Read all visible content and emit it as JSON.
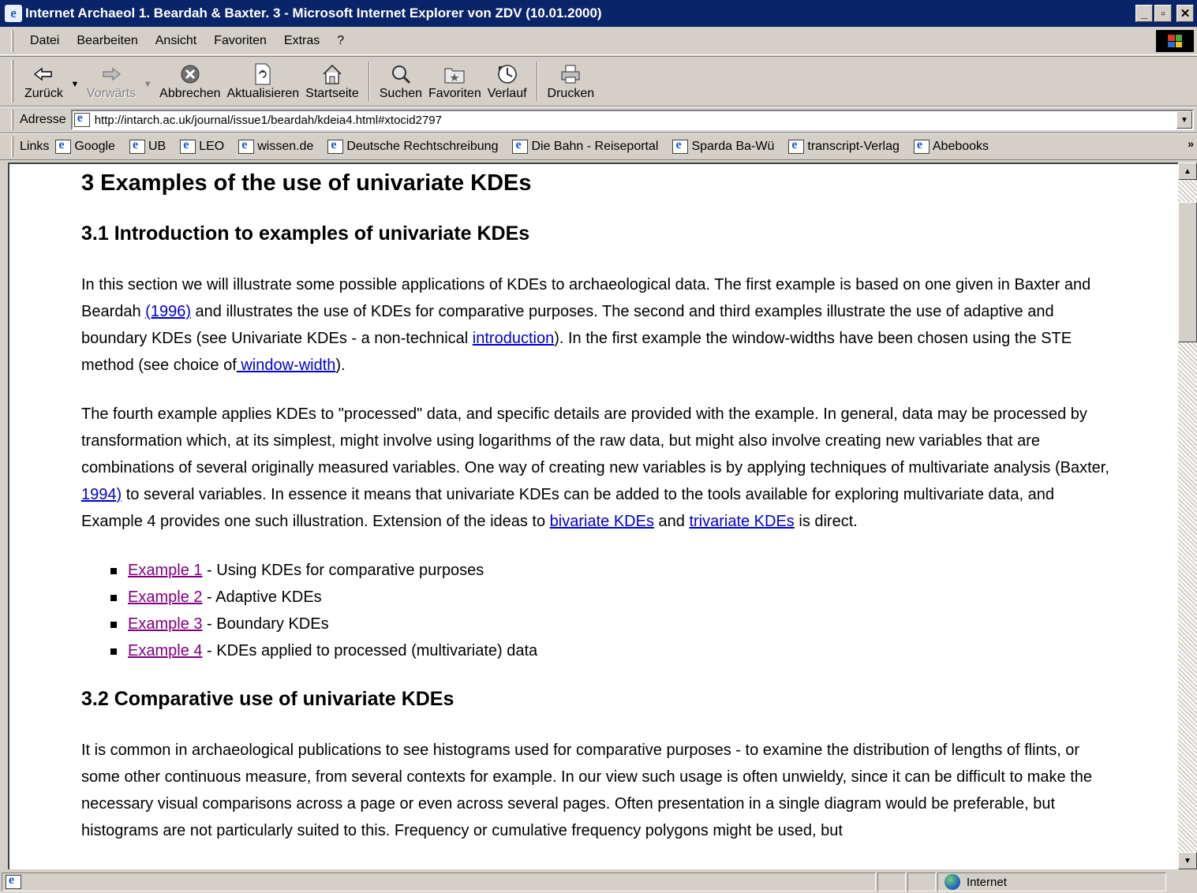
{
  "window": {
    "title": "Internet Archaeol 1. Beardah & Baxter. 3 - Microsoft Internet Explorer von ZDV (10.01.2000)",
    "minimize_label": "_",
    "maximize_label": "▫",
    "close_label": "✕"
  },
  "menu": {
    "items": [
      {
        "label": "Datei"
      },
      {
        "label": "Bearbeiten"
      },
      {
        "label": "Ansicht"
      },
      {
        "label": "Favoriten"
      },
      {
        "label": "Extras"
      },
      {
        "label": "?"
      }
    ]
  },
  "toolbar": {
    "back_label": "Zurück",
    "forward_label": "Vorwärts",
    "stop_label": "Abbrechen",
    "refresh_label": "Aktualisieren",
    "home_label": "Startseite",
    "search_label": "Suchen",
    "favorites_label": "Favoriten",
    "history_label": "Verlauf",
    "print_label": "Drucken"
  },
  "address": {
    "label": "Adresse",
    "url": "http://intarch.ac.uk/journal/issue1/beardah/kdeia4.html#xtocid2797"
  },
  "links": {
    "label": "Links",
    "items": [
      "Google",
      "UB",
      "LEO",
      "wissen.de",
      "Deutsche Rechtschreibung",
      "Die Bahn - Reiseportal",
      "Sparda Ba-Wü",
      "transcript-Verlag",
      "Abebooks"
    ],
    "more": "»"
  },
  "content": {
    "h1": "3 Examples of the use of univariate KDEs",
    "h2_intro": "3.1 Introduction to examples of univariate KDEs",
    "p1": {
      "t1": "In this section we will illustrate some possible applications of KDEs to archaeological data. The first example is based on one given in Baxter and Beardah ",
      "l1": "(1996)",
      "t2": " and illustrates the use of KDEs for comparative purposes. The second and third examples illustrate the use of adaptive and boundary KDEs (see Univariate KDEs - a non-technical ",
      "l2": "introduction",
      "t3": "). In the first example the window-widths have been chosen using the STE method (see choice of",
      "l3": " window-width",
      "t4": ")."
    },
    "p2": {
      "t1": "The fourth example applies KDEs to \"processed\" data, and specific details are provided with the example. In general, data may be processed by transformation which, at its simplest, might involve using logarithms of the raw data, but might also involve creating new variables that are combinations of several originally measured variables. One way of creating new variables is by applying techniques of multivariate analysis (Baxter, ",
      "l1": "1994)",
      "t2": " to several variables. In essence it means that univariate KDEs can be added to the tools available for exploring multivariate data, and Example 4 provides one such illustration. Extension of the ideas to ",
      "l2": "bivariate KDEs",
      "t3": " and ",
      "l3": "trivariate KDEs",
      "t4": " is direct."
    },
    "examples": [
      {
        "link": "Example 1",
        "text": " - Using KDEs for comparative purposes"
      },
      {
        "link": "Example 2",
        "text": " - Adaptive KDEs"
      },
      {
        "link": "Example 3",
        "text": " - Boundary KDEs"
      },
      {
        "link": "Example 4",
        "text": " - KDEs applied to processed (multivariate) data"
      }
    ],
    "h2_comparative": "3.2 Comparative use of univariate KDEs",
    "p3": "It is common in archaeological publications to see histograms used for comparative purposes - to examine the distribution of lengths of flints, or some other continuous measure, from several contexts for example. In our view such usage is often unwieldy, since it can be difficult to make the necessary visual comparisons across a page or even across several pages. Often presentation in a single diagram would be preferable, but histograms are not particularly suited to this. Frequency or cumulative frequency polygons might be used, but"
  },
  "status": {
    "zone": "Internet"
  }
}
